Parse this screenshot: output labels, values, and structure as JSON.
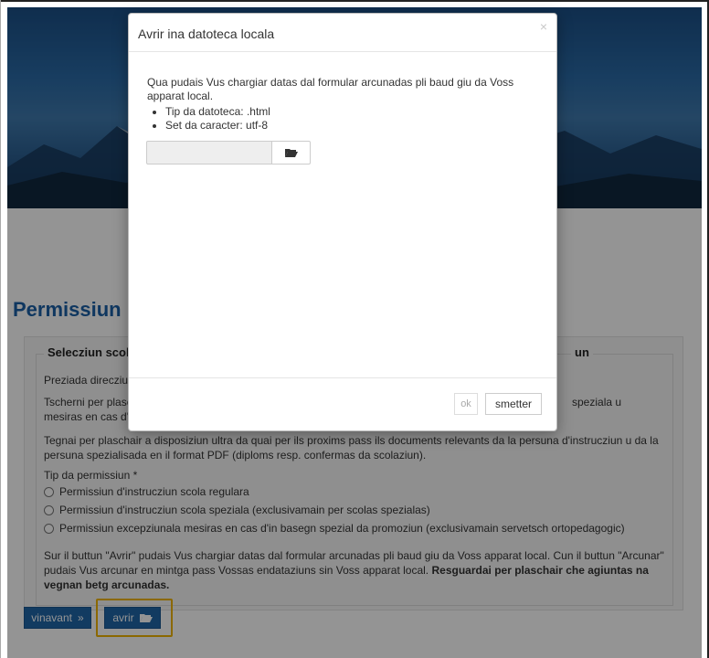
{
  "page": {
    "title": "Permissiun",
    "section_left": "Selecziun scola",
    "section_right": "un",
    "p1": "Preziada direcziun",
    "p2a": "Tscherni per plasch",
    "p2b": "speziala u",
    "p2c": "mesiras en cas d'i",
    "p3": "Tegnai per plaschair a disposiziun ultra da quai per ils proxims pass ils documents relevants da la persuna d'instrucziun u da la persuna spezialisada en il format PDF (diploms resp. confermas da scolaziun).",
    "type_label": "Tip da permissiun *",
    "options": [
      "Permissiun d'instrucziun scola regulara",
      "Permissiun d'instrucziun scola speziala (exclusivamain per scolas spezialas)",
      "Permissiun excepziunala mesiras en cas d'in basegn spezial da promoziun (exclusivamain servetsch ortopedagogic)"
    ],
    "note_normal": "Sur il buttun \"Avrir\" pudais Vus chargiar datas dal formular arcunadas pli baud giu da Voss apparat local. Cun il buttun \"Arcunar\" pudais Vus arcunar en mintga pass Vossas endataziuns sin Voss apparat local.",
    "note_bold": "Resguardai per plaschair che agiuntas na vegnan betg arcunadas.",
    "btn_next": "vinavant",
    "btn_open": "avrir"
  },
  "modal": {
    "title": "Avrir ina datoteca locala",
    "close": "×",
    "intro": "Qua pudais Vus chargiar datas dal formular arcunadas pli baud giu da Voss apparat local.",
    "bullets": [
      "Tip da datoteca: .html",
      "Set da caracter: utf-8"
    ],
    "ok": "ok",
    "cancel": "smetter"
  },
  "icons": {
    "folder": "folder-open-icon",
    "chevron": "double-chevron-right-icon"
  },
  "colors": {
    "primary": "#1f67a8",
    "title": "#1b5fa6",
    "highlight": "#f0b400"
  }
}
